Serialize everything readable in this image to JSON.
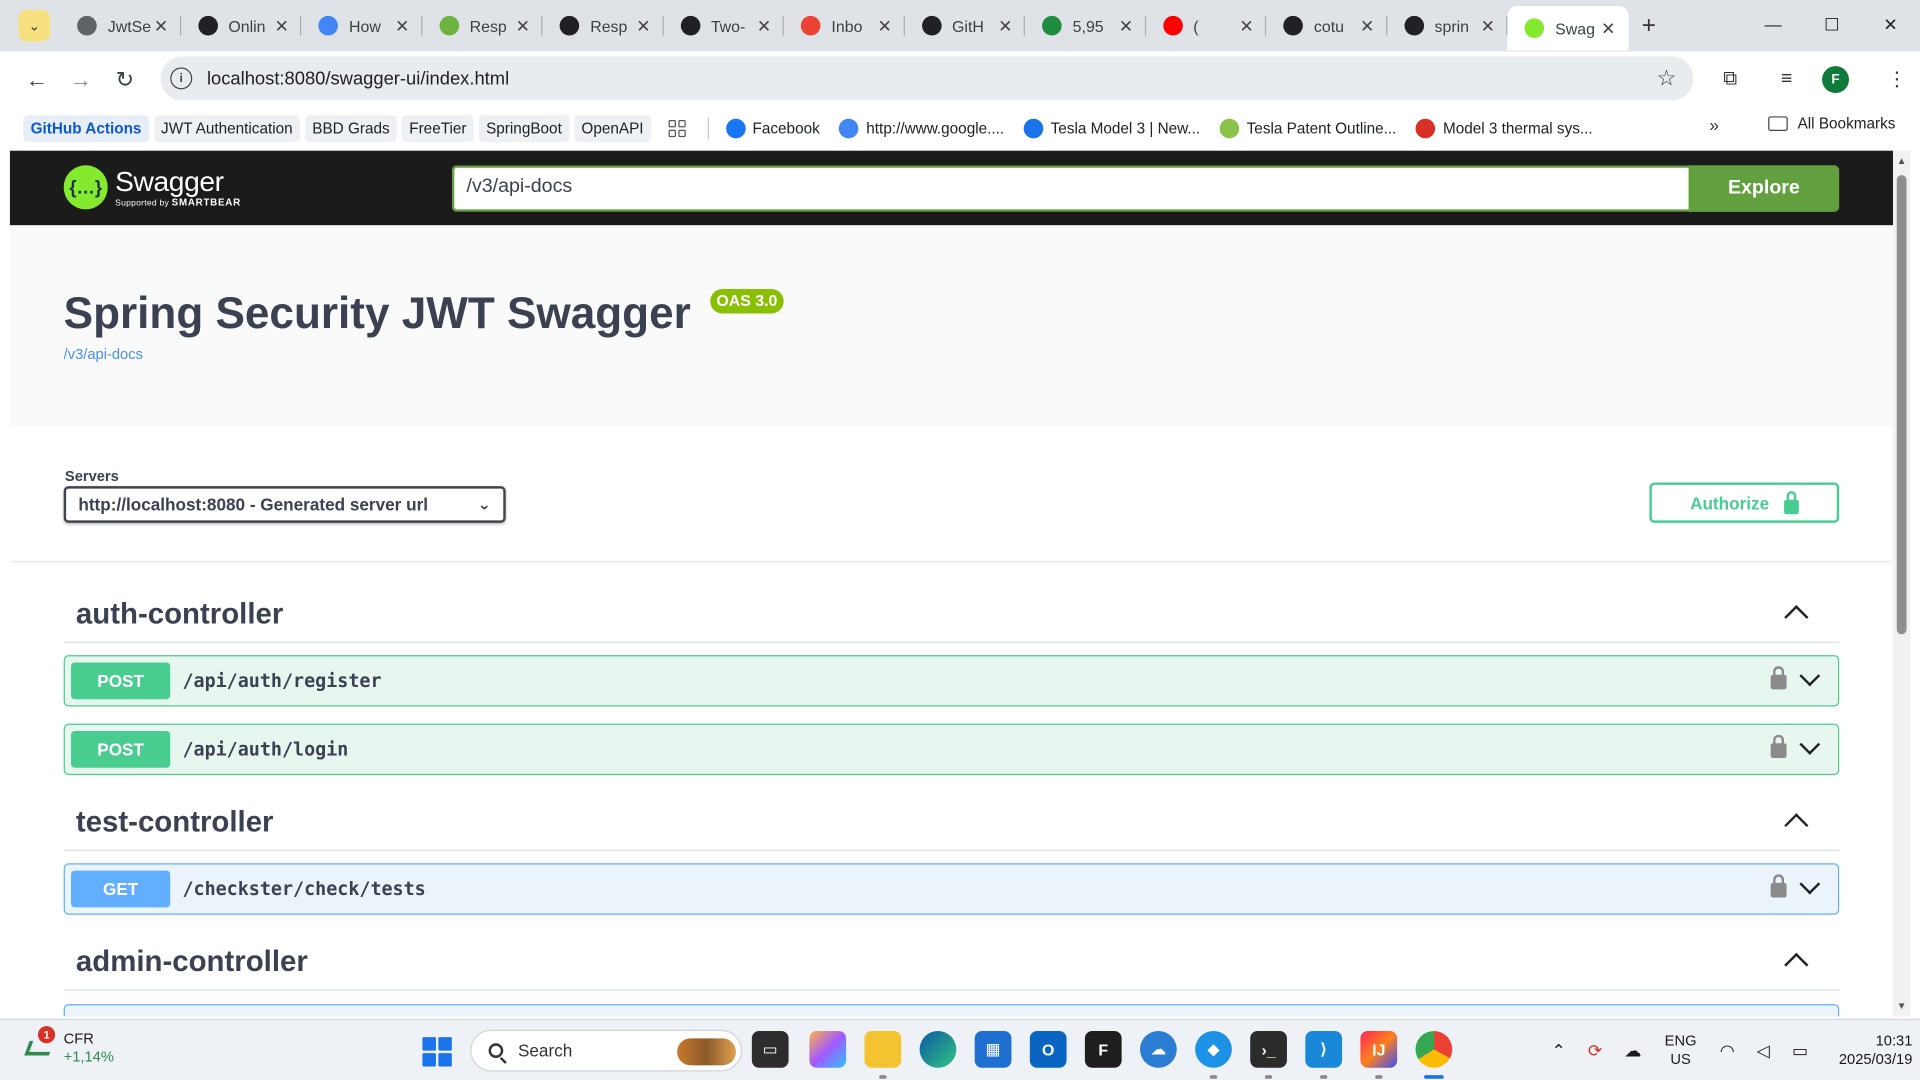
{
  "browser": {
    "tabs": [
      {
        "title": "JwtSe",
        "fav": "globe-icon",
        "color": "#5f6368"
      },
      {
        "title": "Onlin",
        "fav": "openai-icon",
        "color": "#202124"
      },
      {
        "title": "How",
        "fav": "google-icon",
        "color": "#4285f4"
      },
      {
        "title": "Resp",
        "fav": "spring-icon",
        "color": "#6db33f"
      },
      {
        "title": "Resp",
        "fav": "openai-icon",
        "color": "#202124"
      },
      {
        "title": "Two-",
        "fav": "github-icon",
        "color": "#202124"
      },
      {
        "title": "Inbo",
        "fav": "gmail-icon",
        "color": "#ea4335"
      },
      {
        "title": "GitH",
        "fav": "github-icon",
        "color": "#202124"
      },
      {
        "title": "5,95",
        "fav": "sheet-icon",
        "color": "#1e8e3e"
      },
      {
        "title": "(",
        "fav": "youtube-icon",
        "color": "#ff0000"
      },
      {
        "title": "cotu",
        "fav": "github-icon",
        "color": "#202124"
      },
      {
        "title": "sprin",
        "fav": "github-icon",
        "color": "#202124"
      },
      {
        "title": "Swag",
        "fav": "swagger-icon",
        "color": "#85ea2d"
      }
    ],
    "url": "localhost:8080/swagger-ui/index.html",
    "profile_initial": "F",
    "bookmarks_boxed": [
      "GitHub Actions",
      "JWT Authentication",
      "BBD Grads",
      "FreeTier",
      "SpringBoot",
      "OpenAPI"
    ],
    "bookmarks_links": [
      {
        "label": "Facebook",
        "color": "#1877f2"
      },
      {
        "label": "http://www.google....",
        "color": "#4285f4"
      },
      {
        "label": "Tesla Model 3 | New...",
        "color": "#1a73e8"
      },
      {
        "label": "Tesla Patent Outline...",
        "color": "#8bc34a"
      },
      {
        "label": "Model 3 thermal sys...",
        "color": "#d93025"
      }
    ],
    "all_bookmarks": "All Bookmarks"
  },
  "swagger": {
    "brand": "Swagger",
    "brand_sub_prefix": "Supported by",
    "brand_sub": "SMARTBEAR",
    "url_input": "/v3/api-docs",
    "explore": "Explore",
    "title": "Spring Security JWT Swagger",
    "oas_badge": "OAS 3.0",
    "spec_link": "/v3/api-docs",
    "servers_label": "Servers",
    "server_selected": "http://localhost:8080 - Generated server url",
    "authorize": "Authorize",
    "tags": [
      {
        "name": "auth-controller"
      },
      {
        "name": "test-controller"
      },
      {
        "name": "admin-controller"
      }
    ],
    "ops": [
      {
        "method": "POST",
        "path": "/api/auth/register"
      },
      {
        "method": "POST",
        "path": "/api/auth/login"
      },
      {
        "method": "GET",
        "path": "/checkster/check/tests"
      }
    ]
  },
  "taskbar": {
    "ticker": "CFR",
    "ticker_change": "+1,14%",
    "notif_count": "1",
    "search": "Search",
    "lang1": "ENG",
    "lang2": "US",
    "time": "10:31",
    "date": "2025/03/19"
  }
}
